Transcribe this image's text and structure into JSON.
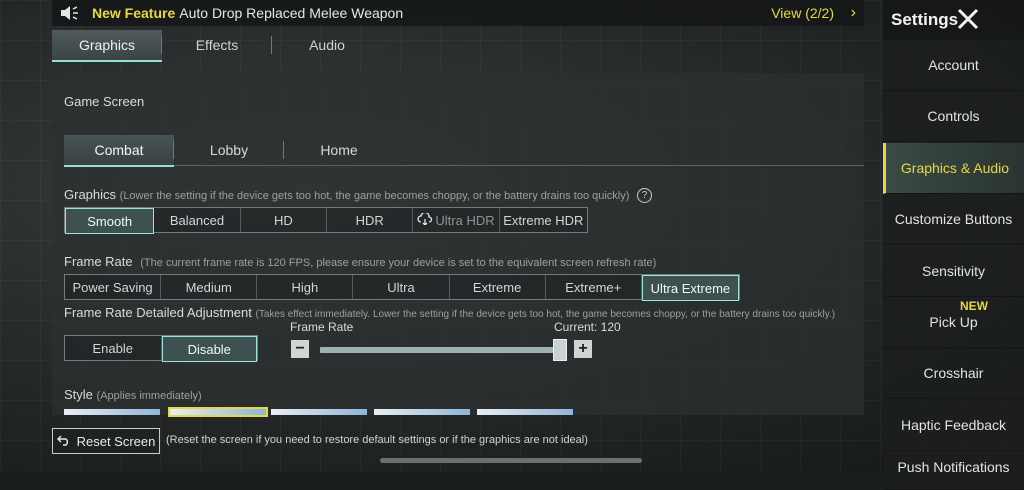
{
  "announcement": {
    "tag": "New Feature",
    "message": "Auto Drop Replaced Melee Weapon",
    "view": "View (2/2)"
  },
  "top_tabs": [
    {
      "label": "Graphics",
      "active": true
    },
    {
      "label": "Effects",
      "active": false
    },
    {
      "label": "Audio",
      "active": false
    }
  ],
  "section_title": "Game Screen",
  "screen_tabs": [
    {
      "label": "Combat",
      "active": true
    },
    {
      "label": "Lobby",
      "active": false
    },
    {
      "label": "Home",
      "active": false
    }
  ],
  "graphics": {
    "label": "Graphics",
    "hint": "(Lower the setting if the device gets too hot, the game becomes choppy, or the battery drains too quickly)",
    "options": [
      "Smooth",
      "Balanced",
      "HD",
      "HDR",
      "Ultra HDR",
      "Extreme HDR"
    ],
    "selected": "Smooth"
  },
  "frame_rate": {
    "label": "Frame Rate",
    "hint": "(The current frame rate is 120 FPS, please ensure your device is set to the equivalent screen refresh rate)",
    "options": [
      "Power Saving",
      "Medium",
      "High",
      "Ultra",
      "Extreme",
      "Extreme+",
      "Ultra Extreme"
    ],
    "selected": "Ultra Extreme"
  },
  "frame_rate_adjust": {
    "label": "Frame Rate Detailed Adjustment",
    "hint": "(Takes effect immediately. Lower the setting if the device gets too hot, the game becomes choppy, or the battery drains too quickly.)",
    "toggle_options": [
      "Enable",
      "Disable"
    ],
    "selected": "Disable",
    "slider_label": "Frame Rate",
    "current_text": "Current: 120",
    "slider_value_fraction": 0.98
  },
  "style": {
    "label": "Style",
    "hint": "(Applies immediately)"
  },
  "reset": {
    "button": "Reset Screen",
    "note": "(Reset the screen if you need to restore default settings or if the graphics are not ideal)"
  },
  "sidebar": {
    "title": "Settings",
    "items": [
      {
        "label": "Account",
        "active": false
      },
      {
        "label": "Controls",
        "active": false
      },
      {
        "label": "Graphics & Audio",
        "active": true
      },
      {
        "label": "Customize Buttons",
        "active": false
      },
      {
        "label": "Sensitivity",
        "active": false
      },
      {
        "label": "Pick Up",
        "active": false,
        "badge": "NEW"
      },
      {
        "label": "Crosshair",
        "active": false
      },
      {
        "label": "Haptic Feedback",
        "active": false
      },
      {
        "label": "Push Notifications",
        "active": false
      }
    ]
  },
  "colors": {
    "accent_yellow": "#e9d83c",
    "accent_teal": "#9be6d8"
  }
}
